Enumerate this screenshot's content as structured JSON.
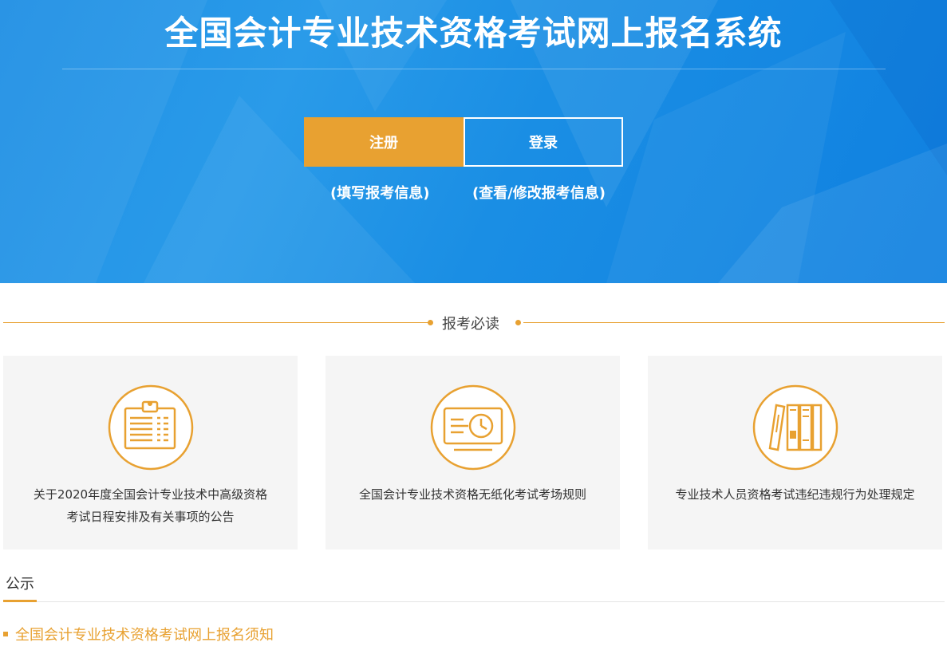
{
  "header": {
    "title": "全国会计专业技术资格考试网上报名系统",
    "register_label": "注册",
    "register_sub": "(填写报考信息)",
    "login_label": "登录",
    "login_sub": "(查看/修改报考信息)"
  },
  "section": {
    "title": "报考必读"
  },
  "cards": [
    {
      "icon": "clipboard-schedule-icon",
      "text_line1": "关于2020年度全国会计专业技术中高级资格",
      "text_line2": "考试日程安排及有关事项的公告"
    },
    {
      "icon": "monitor-clock-icon",
      "text_line1": "全国会计专业技术资格无纸化考试考场规则",
      "text_line2": ""
    },
    {
      "icon": "books-binders-icon",
      "text_line1": "专业技术人员资格考试违纪违规行为处理规定",
      "text_line2": ""
    }
  ],
  "tabs": {
    "active_label": "公示"
  },
  "notices": [
    {
      "label": "全国会计专业技术资格考试网上报名须知"
    }
  ],
  "colors": {
    "accent": "#e8a131",
    "banner_blue": "#1a8ee4",
    "card_bg": "#f5f5f5"
  }
}
